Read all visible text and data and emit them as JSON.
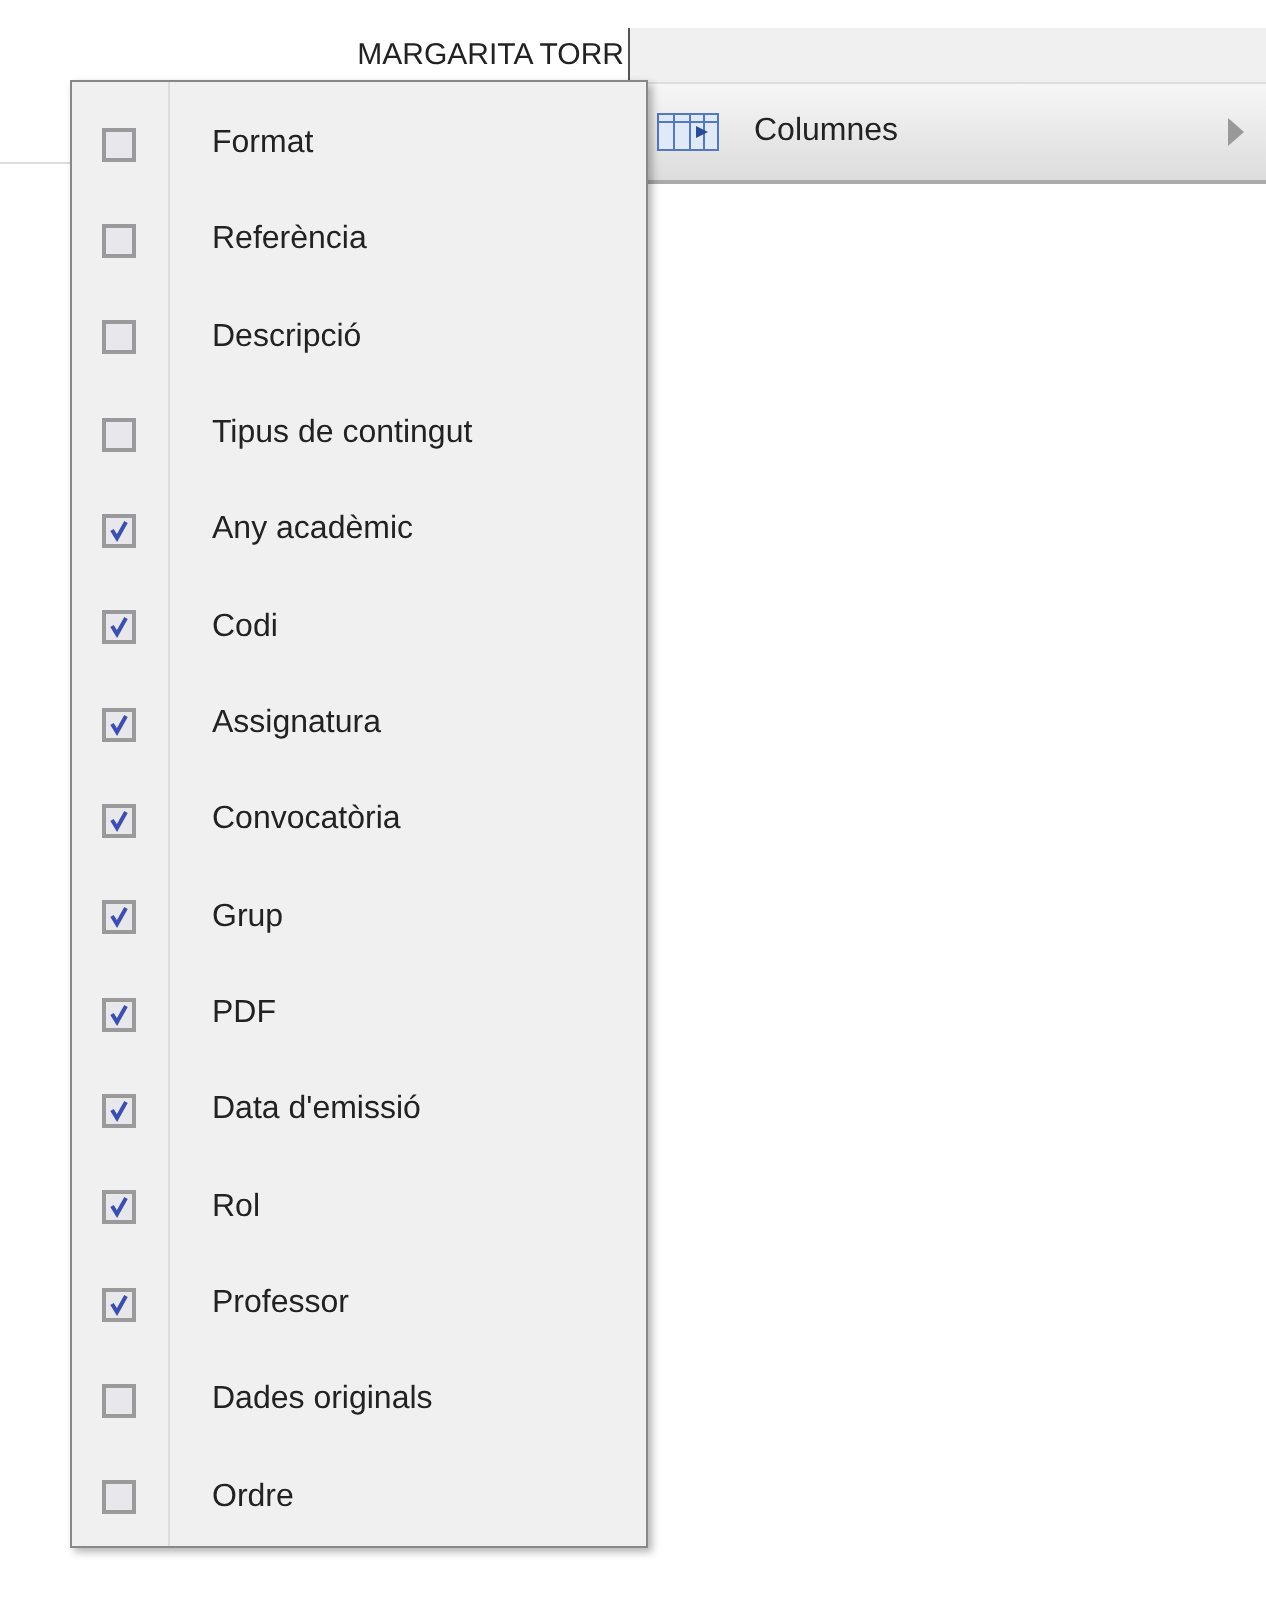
{
  "cell_text": "MARGARITA TORR",
  "parent_menu": {
    "label": "Columnes",
    "has_submenu": true
  },
  "columns_menu": [
    {
      "label": "Format",
      "checked": false
    },
    {
      "label": "Referència",
      "checked": false
    },
    {
      "label": "Descripció",
      "checked": false
    },
    {
      "label": "Tipus de contingut",
      "checked": false
    },
    {
      "label": "Any acadèmic",
      "checked": true
    },
    {
      "label": "Codi",
      "checked": true
    },
    {
      "label": "Assignatura",
      "checked": true
    },
    {
      "label": "Convocatòria",
      "checked": true
    },
    {
      "label": "Grup",
      "checked": true
    },
    {
      "label": "PDF",
      "checked": true
    },
    {
      "label": "Data d'emissió",
      "checked": true
    },
    {
      "label": "Rol",
      "checked": true
    },
    {
      "label": "Professor",
      "checked": true
    },
    {
      "label": "Dades originals",
      "checked": false
    },
    {
      "label": "Ordre",
      "checked": false
    }
  ]
}
